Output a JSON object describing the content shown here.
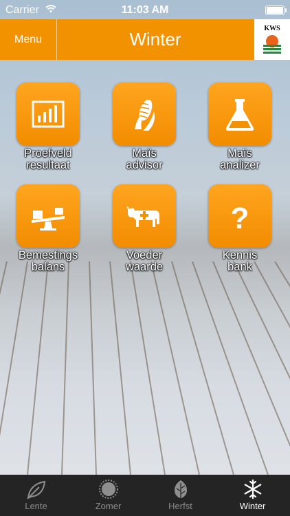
{
  "status": {
    "carrier": "Carrier",
    "time": "11:03 AM"
  },
  "nav": {
    "menu_label": "Menu",
    "title": "Winter",
    "logo_text": "KWS"
  },
  "grid": [
    {
      "line1": "Proefveld",
      "line2": "resultaat",
      "icon": "chart-icon"
    },
    {
      "line1": "Maïs",
      "line2": "advisor",
      "icon": "corn-icon"
    },
    {
      "line1": "Maïs",
      "line2": "analizer",
      "icon": "flask-icon"
    },
    {
      "line1": "Bemestings",
      "line2": "balans",
      "icon": "balance-icon"
    },
    {
      "line1": "Voeder",
      "line2": "waarde",
      "icon": "cow-icon"
    },
    {
      "line1": "Kennis",
      "line2": "bank",
      "icon": "question-icon"
    }
  ],
  "tabs": [
    {
      "label": "Lente",
      "icon": "leaf-icon"
    },
    {
      "label": "Zomer",
      "icon": "sun-icon"
    },
    {
      "label": "Herfst",
      "icon": "autumn-leaf-icon"
    },
    {
      "label": "Winter",
      "icon": "snowflake-icon",
      "active": true
    }
  ],
  "colors": {
    "accent": "#f39200",
    "tabbar": "#242424",
    "tab_inactive": "#8e8e8e",
    "tab_active": "#ffffff"
  }
}
